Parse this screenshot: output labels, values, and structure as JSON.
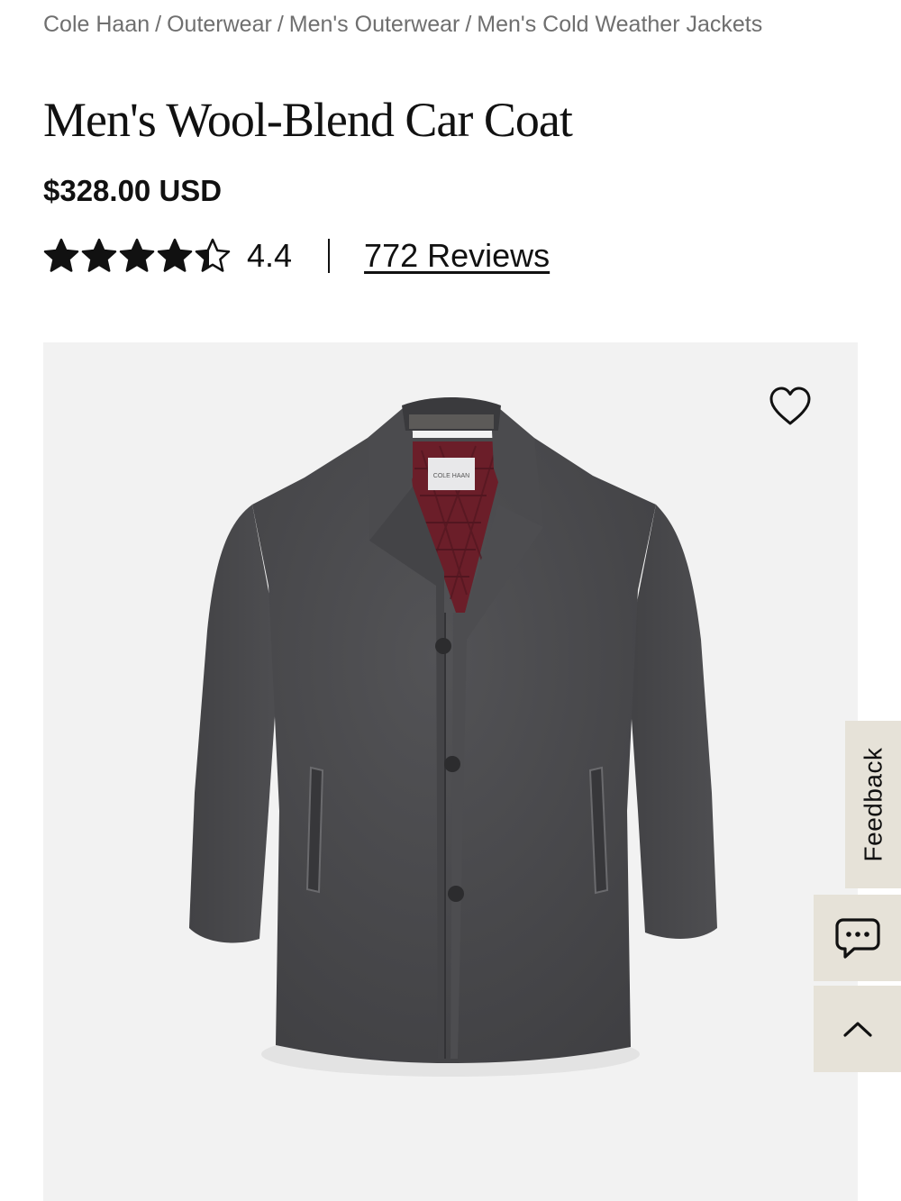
{
  "breadcrumb": [
    {
      "label": "Cole Haan"
    },
    {
      "label": "Outerwear"
    },
    {
      "label": "Men's Outerwear"
    },
    {
      "label": "Men's Cold Weather Jackets"
    }
  ],
  "breadcrumb_separator": "/",
  "product": {
    "title": "Men's Wool-Blend Car Coat",
    "price": "$328.00 USD",
    "rating": "4.4",
    "rating_value": 4.4,
    "rating_max": 5,
    "reviews_label": "772 Reviews",
    "image_label_text": "COLE HAAN"
  },
  "icons": {
    "wishlist": "heart-icon",
    "chat": "chat-bubble-icon",
    "back_to_top": "chevron-up-icon",
    "star": "star-icon"
  },
  "side_widgets": {
    "feedback_label": "Feedback"
  },
  "colors": {
    "image_background": "#f2f2f2",
    "side_widget_background": "#e6e2d8",
    "coat": "#48484a",
    "lining": "#6b1e29"
  }
}
